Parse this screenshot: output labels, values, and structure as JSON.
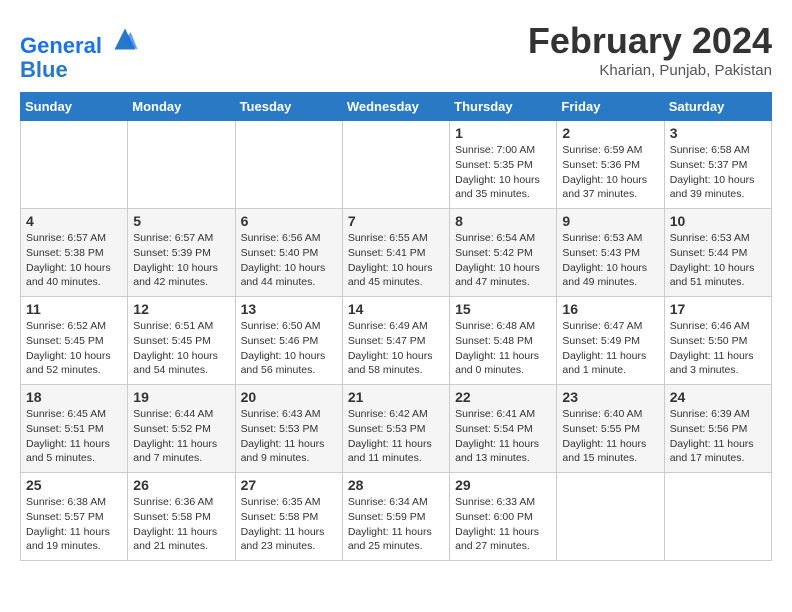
{
  "header": {
    "logo_line1": "General",
    "logo_line2": "Blue",
    "month": "February 2024",
    "location": "Kharian, Punjab, Pakistan"
  },
  "weekdays": [
    "Sunday",
    "Monday",
    "Tuesday",
    "Wednesday",
    "Thursday",
    "Friday",
    "Saturday"
  ],
  "weeks": [
    [
      {
        "day": "",
        "info": ""
      },
      {
        "day": "",
        "info": ""
      },
      {
        "day": "",
        "info": ""
      },
      {
        "day": "",
        "info": ""
      },
      {
        "day": "1",
        "info": "Sunrise: 7:00 AM\nSunset: 5:35 PM\nDaylight: 10 hours\nand 35 minutes."
      },
      {
        "day": "2",
        "info": "Sunrise: 6:59 AM\nSunset: 5:36 PM\nDaylight: 10 hours\nand 37 minutes."
      },
      {
        "day": "3",
        "info": "Sunrise: 6:58 AM\nSunset: 5:37 PM\nDaylight: 10 hours\nand 39 minutes."
      }
    ],
    [
      {
        "day": "4",
        "info": "Sunrise: 6:57 AM\nSunset: 5:38 PM\nDaylight: 10 hours\nand 40 minutes."
      },
      {
        "day": "5",
        "info": "Sunrise: 6:57 AM\nSunset: 5:39 PM\nDaylight: 10 hours\nand 42 minutes."
      },
      {
        "day": "6",
        "info": "Sunrise: 6:56 AM\nSunset: 5:40 PM\nDaylight: 10 hours\nand 44 minutes."
      },
      {
        "day": "7",
        "info": "Sunrise: 6:55 AM\nSunset: 5:41 PM\nDaylight: 10 hours\nand 45 minutes."
      },
      {
        "day": "8",
        "info": "Sunrise: 6:54 AM\nSunset: 5:42 PM\nDaylight: 10 hours\nand 47 minutes."
      },
      {
        "day": "9",
        "info": "Sunrise: 6:53 AM\nSunset: 5:43 PM\nDaylight: 10 hours\nand 49 minutes."
      },
      {
        "day": "10",
        "info": "Sunrise: 6:53 AM\nSunset: 5:44 PM\nDaylight: 10 hours\nand 51 minutes."
      }
    ],
    [
      {
        "day": "11",
        "info": "Sunrise: 6:52 AM\nSunset: 5:45 PM\nDaylight: 10 hours\nand 52 minutes."
      },
      {
        "day": "12",
        "info": "Sunrise: 6:51 AM\nSunset: 5:45 PM\nDaylight: 10 hours\nand 54 minutes."
      },
      {
        "day": "13",
        "info": "Sunrise: 6:50 AM\nSunset: 5:46 PM\nDaylight: 10 hours\nand 56 minutes."
      },
      {
        "day": "14",
        "info": "Sunrise: 6:49 AM\nSunset: 5:47 PM\nDaylight: 10 hours\nand 58 minutes."
      },
      {
        "day": "15",
        "info": "Sunrise: 6:48 AM\nSunset: 5:48 PM\nDaylight: 11 hours\nand 0 minutes."
      },
      {
        "day": "16",
        "info": "Sunrise: 6:47 AM\nSunset: 5:49 PM\nDaylight: 11 hours\nand 1 minute."
      },
      {
        "day": "17",
        "info": "Sunrise: 6:46 AM\nSunset: 5:50 PM\nDaylight: 11 hours\nand 3 minutes."
      }
    ],
    [
      {
        "day": "18",
        "info": "Sunrise: 6:45 AM\nSunset: 5:51 PM\nDaylight: 11 hours\nand 5 minutes."
      },
      {
        "day": "19",
        "info": "Sunrise: 6:44 AM\nSunset: 5:52 PM\nDaylight: 11 hours\nand 7 minutes."
      },
      {
        "day": "20",
        "info": "Sunrise: 6:43 AM\nSunset: 5:53 PM\nDaylight: 11 hours\nand 9 minutes."
      },
      {
        "day": "21",
        "info": "Sunrise: 6:42 AM\nSunset: 5:53 PM\nDaylight: 11 hours\nand 11 minutes."
      },
      {
        "day": "22",
        "info": "Sunrise: 6:41 AM\nSunset: 5:54 PM\nDaylight: 11 hours\nand 13 minutes."
      },
      {
        "day": "23",
        "info": "Sunrise: 6:40 AM\nSunset: 5:55 PM\nDaylight: 11 hours\nand 15 minutes."
      },
      {
        "day": "24",
        "info": "Sunrise: 6:39 AM\nSunset: 5:56 PM\nDaylight: 11 hours\nand 17 minutes."
      }
    ],
    [
      {
        "day": "25",
        "info": "Sunrise: 6:38 AM\nSunset: 5:57 PM\nDaylight: 11 hours\nand 19 minutes."
      },
      {
        "day": "26",
        "info": "Sunrise: 6:36 AM\nSunset: 5:58 PM\nDaylight: 11 hours\nand 21 minutes."
      },
      {
        "day": "27",
        "info": "Sunrise: 6:35 AM\nSunset: 5:58 PM\nDaylight: 11 hours\nand 23 minutes."
      },
      {
        "day": "28",
        "info": "Sunrise: 6:34 AM\nSunset: 5:59 PM\nDaylight: 11 hours\nand 25 minutes."
      },
      {
        "day": "29",
        "info": "Sunrise: 6:33 AM\nSunset: 6:00 PM\nDaylight: 11 hours\nand 27 minutes."
      },
      {
        "day": "",
        "info": ""
      },
      {
        "day": "",
        "info": ""
      }
    ]
  ]
}
